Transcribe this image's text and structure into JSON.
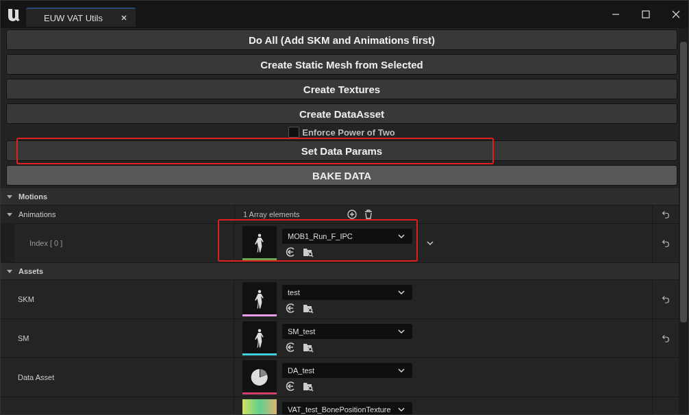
{
  "window": {
    "title": "EUW VAT Utils"
  },
  "actions": [
    {
      "kind": "button",
      "label": "Do All (Add SKM and Animations first)",
      "highlighted": false
    },
    {
      "kind": "button",
      "label": "Create Static Mesh from Selected",
      "highlighted": false
    },
    {
      "kind": "button",
      "label": "Create Textures",
      "highlighted": false
    },
    {
      "kind": "button",
      "label": "Create DataAsset",
      "highlighted": false
    },
    {
      "kind": "checkbox",
      "label": "Enforce Power of Two",
      "checked": false
    },
    {
      "kind": "button",
      "label": "Set Data Params",
      "highlighted": true
    },
    {
      "kind": "primary",
      "label": "BAKE DATA",
      "highlighted": false
    }
  ],
  "sections": [
    {
      "title": "Motions",
      "expanded": true,
      "rows": [
        {
          "kind": "array",
          "name": "Animations",
          "expanded": true,
          "count_text": "1 Array elements",
          "resettable": true,
          "children": [
            {
              "kind": "figure",
              "name": "Index [ 0 ]",
              "asset": "MOB1_Run_F_IPC",
              "color": "#6aa84f",
              "resettable": true,
              "highlighted": true,
              "expandable": true
            }
          ]
        }
      ]
    },
    {
      "title": "Assets",
      "expanded": true,
      "rows": [
        {
          "kind": "figure",
          "name": "SKM",
          "asset": "test",
          "color": "#e89ee6",
          "resettable": true
        },
        {
          "kind": "figure",
          "name": "SM",
          "asset": "SM_test",
          "color": "#3fd0e0",
          "resettable": true
        },
        {
          "kind": "pie",
          "name": "Data Asset",
          "asset": "DA_test",
          "color": "#d0406a",
          "resettable": false
        },
        {
          "kind": "texture",
          "asset": "VAT_test_BonePositionTexture",
          "resettable": false
        }
      ]
    }
  ]
}
